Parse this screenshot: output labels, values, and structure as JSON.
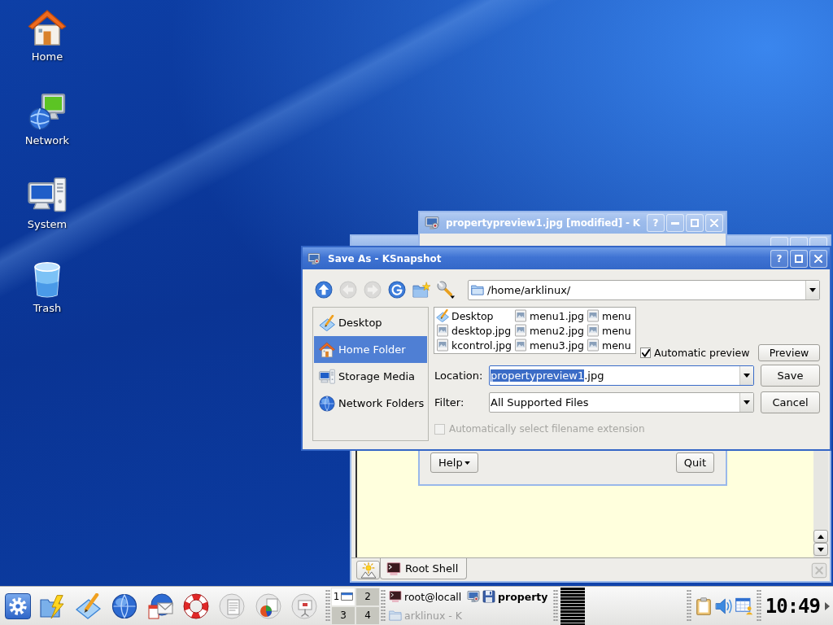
{
  "desktop_icons": [
    {
      "label": "Home",
      "kind": "home"
    },
    {
      "label": "Network",
      "kind": "network"
    },
    {
      "label": "System",
      "kind": "system"
    },
    {
      "label": "Trash",
      "kind": "trash"
    }
  ],
  "terminal_window": {
    "active": false,
    "tabs": [
      {
        "label": "Root Shell",
        "selected": true
      }
    ]
  },
  "snapshot_window": {
    "active": false,
    "title": "propertypreview1.jpg [modified] - K",
    "title_buttons": [
      {
        "kind": "help",
        "label": "?"
      },
      {
        "kind": "minimize"
      },
      {
        "kind": "maximize"
      },
      {
        "kind": "close"
      }
    ],
    "buttons": [
      {
        "label": "Help",
        "kind": "menu"
      },
      {
        "label": "Quit",
        "kind": "plain"
      }
    ]
  },
  "save_dialog": {
    "active": true,
    "title": "Save As - KSnapshot",
    "title_buttons": [
      {
        "kind": "help",
        "label": "?"
      },
      {
        "kind": "maximize"
      },
      {
        "kind": "close"
      }
    ],
    "toolbar": [
      {
        "kind": "up",
        "disabled": false
      },
      {
        "kind": "back",
        "disabled": true
      },
      {
        "kind": "forward",
        "disabled": true
      },
      {
        "kind": "reload",
        "disabled": false
      },
      {
        "kind": "new_folder",
        "disabled": false
      },
      {
        "kind": "settings",
        "disabled": false
      }
    ],
    "path": "/home/arklinux/",
    "places": [
      {
        "label": "Desktop",
        "kind": "desktop",
        "selected": false
      },
      {
        "label": "Home Folder",
        "kind": "home",
        "selected": true
      },
      {
        "label": "Storage Media",
        "kind": "storage",
        "selected": false
      },
      {
        "label": "Network Folders",
        "kind": "network",
        "selected": false
      }
    ],
    "files": [
      {
        "name": "Desktop",
        "kind": "desktop_folder"
      },
      {
        "name": "desktop.jpg",
        "kind": "image"
      },
      {
        "name": "kcontrol.jpg",
        "kind": "image"
      },
      {
        "name": "menu1.jpg",
        "kind": "image"
      },
      {
        "name": "menu2.jpg",
        "kind": "image"
      },
      {
        "name": "menu3.jpg",
        "kind": "image"
      },
      {
        "name": "menu",
        "kind": "image"
      },
      {
        "name": "menu",
        "kind": "image"
      },
      {
        "name": "menu",
        "kind": "image"
      }
    ],
    "preview": {
      "label": "Automatic preview",
      "checked": true,
      "button": "Preview"
    },
    "location": {
      "label": "Location:",
      "parts": [
        {
          "text": "propertypreview1",
          "selected": true
        },
        {
          "text": ".jpg",
          "selected": false
        }
      ]
    },
    "filter": {
      "label": "Filter:",
      "value": "All Supported Files"
    },
    "buttons": [
      {
        "label": "Save"
      },
      {
        "label": "Cancel"
      }
    ],
    "extension_option": {
      "label": "Automatically select filename extension",
      "checked": false,
      "disabled": true
    }
  },
  "taskbar": {
    "launchers": [
      {
        "kind": "folder"
      },
      {
        "kind": "pencil"
      },
      {
        "kind": "globe"
      },
      {
        "kind": "mail"
      },
      {
        "kind": "lifebuoy"
      },
      {
        "kind": "document"
      },
      {
        "kind": "spreadsheet"
      },
      {
        "kind": "presentation"
      }
    ],
    "desktops": [
      {
        "label": "1",
        "selected": true
      },
      {
        "label": "2",
        "selected": false
      },
      {
        "label": "3",
        "selected": false
      },
      {
        "label": "4",
        "selected": false
      }
    ],
    "tasks": [
      {
        "label": "root@locall",
        "kind": "terminal",
        "selected": false,
        "minimized": false
      },
      {
        "label": "property",
        "kind": "snapshot",
        "selected": true,
        "minimized": false
      },
      {
        "label": "arklinux - K",
        "kind": "folder",
        "selected": false,
        "minimized": true
      }
    ],
    "tray": [
      {
        "kind": "clipboard"
      },
      {
        "kind": "speaker"
      },
      {
        "kind": "calendar"
      }
    ],
    "clock": "10:49"
  }
}
